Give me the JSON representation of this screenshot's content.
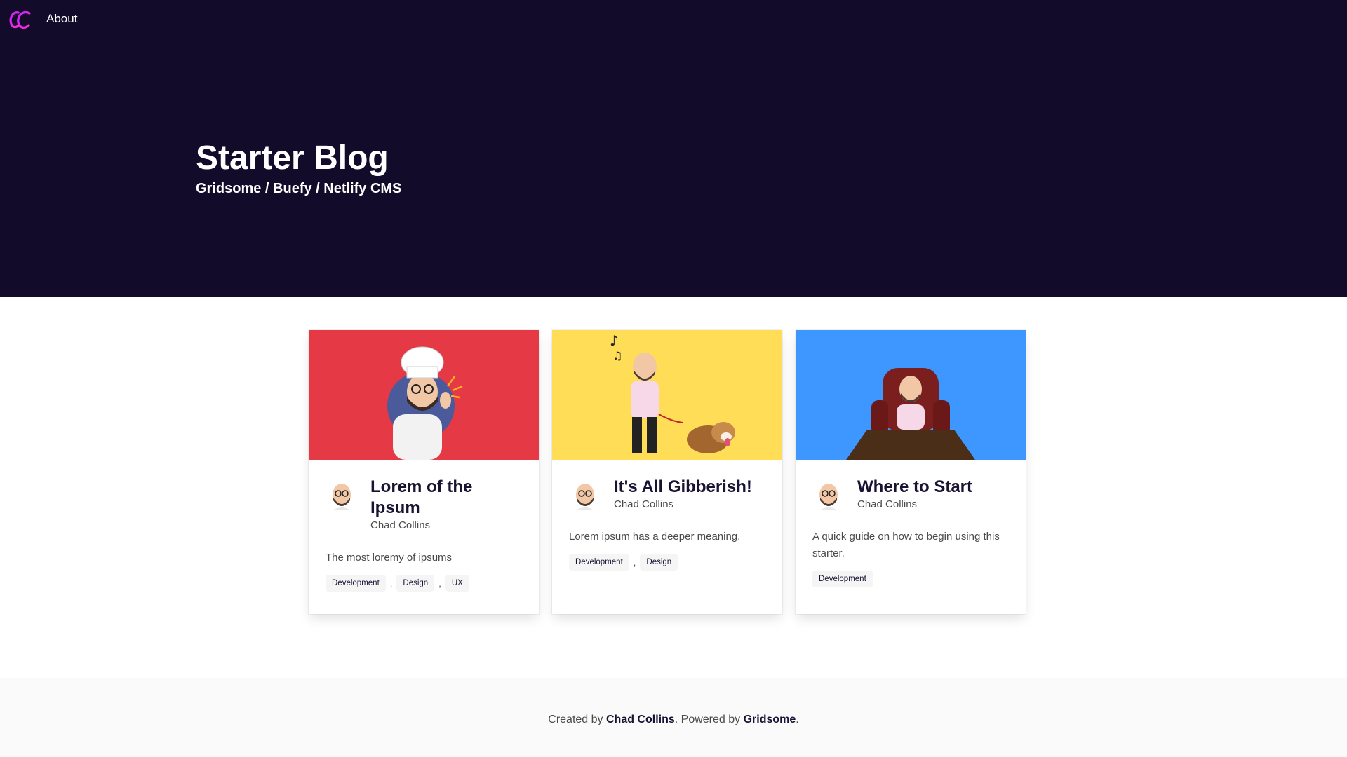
{
  "nav": {
    "logo_icon": "cc-logo-icon",
    "about_label": "About"
  },
  "hero": {
    "title": "Starter Blog",
    "subtitle": "Gridsome / Buefy / Netlify CMS"
  },
  "posts": [
    {
      "image_bg": "#e63946",
      "title": "Lorem of the Ipsum",
      "author": "Chad Collins",
      "description": "The most loremy of ipsums",
      "tags": [
        "Development",
        "Design",
        "UX"
      ]
    },
    {
      "image_bg": "#ffdd57",
      "title": "It's All Gibberish!",
      "author": "Chad Collins",
      "description": "Lorem ipsum has a deeper meaning.",
      "tags": [
        "Development",
        "Design"
      ]
    },
    {
      "image_bg": "#3e97ff",
      "title": "Where to Start",
      "author": "Chad Collins",
      "description": "A quick guide on how to begin using this starter.",
      "tags": [
        "Development"
      ]
    }
  ],
  "footer": {
    "created_by": "Created by ",
    "author": "Chad Collins",
    "powered_by": ". Powered by ",
    "framework": "Gridsome",
    "end": "."
  },
  "colors": {
    "hero_bg": "#130b2a",
    "footer_bg": "#fafafa",
    "tag_bg": "#f5f5f5"
  }
}
